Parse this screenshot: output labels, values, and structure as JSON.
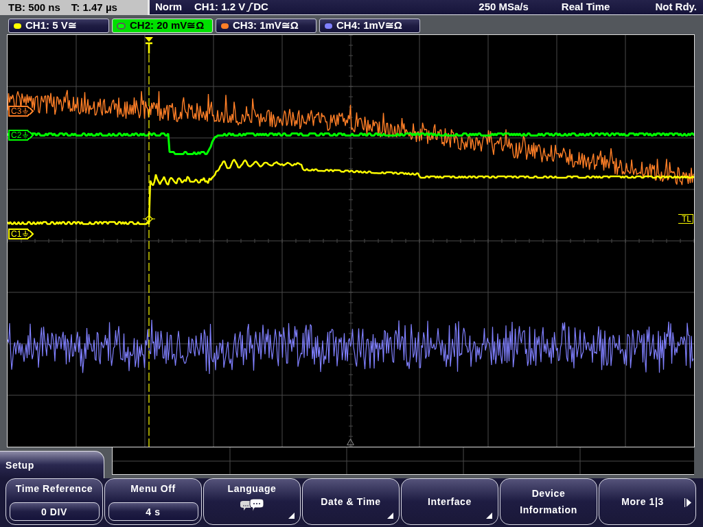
{
  "status_bar": {
    "timebase": "TB: 500 ns",
    "trigger_time": "T: 1.47 µs",
    "trigger_mode": "Norm",
    "trigger_level": "CH1: 1.2 V",
    "trigger_coupling": "DC",
    "sample_rate": "250 MSa/s",
    "acquisition_mode": "Real Time",
    "acquisition_state": "Not Rdy."
  },
  "channels": [
    {
      "label": "CH1: 5 V≅",
      "color": "#ffff00",
      "selected": false
    },
    {
      "label": "CH2: 20 mV≅Ω",
      "color": "#00ff00",
      "selected": true
    },
    {
      "label": "CH3: 1mV≅Ω",
      "color": "#ff7f27",
      "selected": false
    },
    {
      "label": "CH4: 1mV≅Ω",
      "color": "#8080ff",
      "selected": false
    }
  ],
  "markers": [
    {
      "label": "C3",
      "color": "#ff7f27"
    },
    {
      "label": "C2",
      "color": "#00ff00"
    },
    {
      "label": "C1",
      "color": "#ffff00"
    }
  ],
  "trigger_level_marker": "TL",
  "menu": {
    "title": "Setup",
    "softkeys": [
      {
        "kind": "value",
        "label": "Time Reference",
        "value": "0 DIV"
      },
      {
        "kind": "value",
        "label": "Menu Off",
        "value": "4 s"
      },
      {
        "kind": "iconmenu",
        "label": "Language"
      },
      {
        "kind": "submenu",
        "label": "Date & Time"
      },
      {
        "kind": "submenu",
        "label": "Interface"
      },
      {
        "kind": "plain",
        "label": "Device Information"
      },
      {
        "kind": "more",
        "label": "More 1|3"
      }
    ]
  }
}
